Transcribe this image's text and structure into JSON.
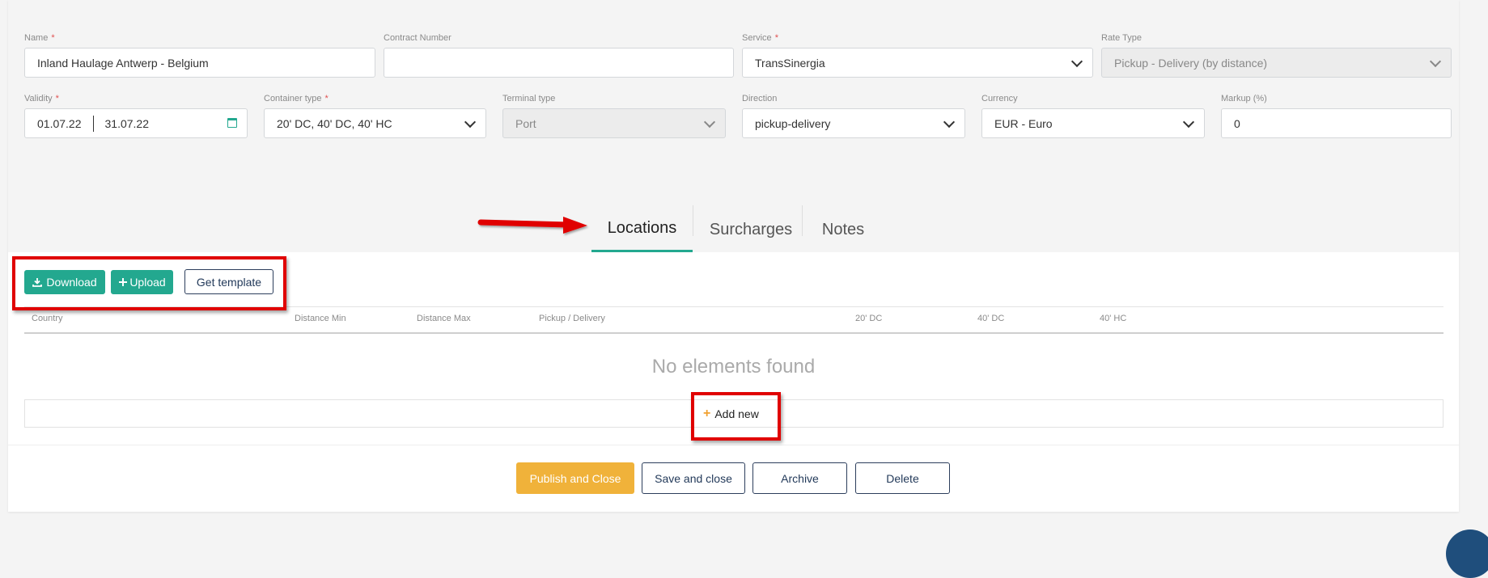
{
  "form": {
    "name": {
      "label": "Name",
      "required": "*",
      "value": "Inland Haulage Antwerp - Belgium"
    },
    "contract": {
      "label": "Contract Number",
      "value": ""
    },
    "service": {
      "label": "Service",
      "required": "*",
      "value": "TransSinergia"
    },
    "rate_type": {
      "label": "Rate Type",
      "value": "Pickup - Delivery (by distance)"
    },
    "validity": {
      "label": "Validity",
      "required": "*",
      "from": "01.07.22",
      "to": "31.07.22"
    },
    "container_type": {
      "label": "Container type",
      "required": "*",
      "value": "20' DC, 40' DC, 40' HC"
    },
    "terminal_type": {
      "label": "Terminal type",
      "value": "Port"
    },
    "direction": {
      "label": "Direction",
      "value": "pickup-delivery"
    },
    "currency": {
      "label": "Currency",
      "value": "EUR - Euro"
    },
    "markup": {
      "label": "Markup (%)",
      "value": "0"
    }
  },
  "tabs": [
    {
      "label": "Locations",
      "active": true
    },
    {
      "label": "Surcharges",
      "active": false
    },
    {
      "label": "Notes",
      "active": false
    }
  ],
  "toolbar": {
    "download": "Download",
    "upload": "Upload",
    "template": "Get template"
  },
  "table": {
    "columns": [
      "Country",
      "Distance Min",
      "Distance Max",
      "Pickup / Delivery",
      "20' DC",
      "40' DC",
      "40' HC"
    ],
    "empty_text": "No elements found",
    "add_new": "Add new"
  },
  "actions": {
    "publish": "Publish and Close",
    "save": "Save and close",
    "archive": "Archive",
    "delete": "Delete"
  },
  "colors": {
    "accent": "#23a88f",
    "publish": "#f0b23a",
    "annotation": "#e00000"
  }
}
